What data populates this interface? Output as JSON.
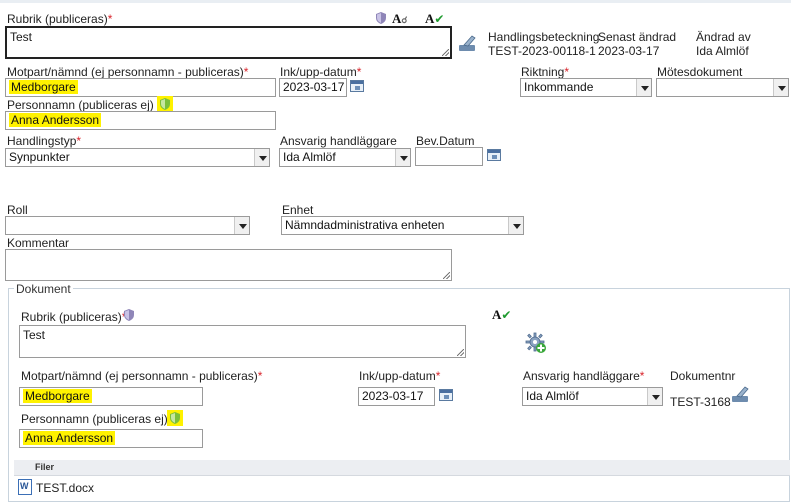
{
  "header": {
    "rubrik_label": "Rubrik (publiceras)",
    "rubrik_value": "Test",
    "handlingsbeteckning_label": "Handlingsbeteckning",
    "handlingsbeteckning_value": "TEST-2023-00118-1",
    "senast_andrad_label": "Senast ändrad",
    "senast_andrad_value": "2023-03-17",
    "andrad_av_label": "Ändrad av",
    "andrad_av_value": "Ida Almlöf"
  },
  "form": {
    "motpart_label": "Motpart/nämnd (ej personnamn - publiceras)",
    "motpart_value": "Medborgare",
    "ink_label": "Ink/upp-datum",
    "ink_value": "2023-03-17",
    "riktning_label": "Riktning",
    "riktning_value": "Inkommande",
    "motesdokument_label": "Mötesdokument",
    "motesdokument_value": "",
    "personnamn_label": "Personnamn (publiceras ej)",
    "personnamn_value": "Anna Andersson",
    "handlingstyp_label": "Handlingstyp",
    "handlingstyp_value": "Synpunkter",
    "ansvarig_label": "Ansvarig handläggare",
    "ansvarig_value": "Ida Almlöf",
    "bevdatum_label": "Bev.Datum",
    "bevdatum_value": "",
    "roll_label": "Roll",
    "roll_value": "",
    "enhet_label": "Enhet",
    "enhet_value": "Nämndadministrativa enheten",
    "kommentar_label": "Kommentar",
    "kommentar_value": "",
    "required_mark": "*",
    "spell_label": "A"
  },
  "dokument": {
    "legend": "Dokument",
    "rubrik_label": "Rubrik (publiceras)",
    "rubrik_value": "Test",
    "motpart_label": "Motpart/nämnd (ej personnamn - publiceras)",
    "motpart_value": "Medborgare",
    "ink_label": "Ink/upp-datum",
    "ink_value": "2023-03-17",
    "ansvarig_label": "Ansvarig handläggare",
    "ansvarig_value": "Ida Almlöf",
    "dokumentnr_label": "Dokumentnr",
    "dokumentnr_value": "TEST-3168",
    "personnamn_label": "Personnamn (publiceras ej)",
    "personnamn_value": "Anna Andersson",
    "filer_header": "Filer",
    "file_name": "TEST.docx"
  },
  "colors": {
    "highlight": "#fff200",
    "required": "#d8232a",
    "spellcheck": "#1e9a2e"
  },
  "icons": [
    "shield-icon",
    "spellcheck-icon",
    "clear-icon",
    "calendar-icon",
    "settings-add-icon",
    "word-document-icon"
  ]
}
